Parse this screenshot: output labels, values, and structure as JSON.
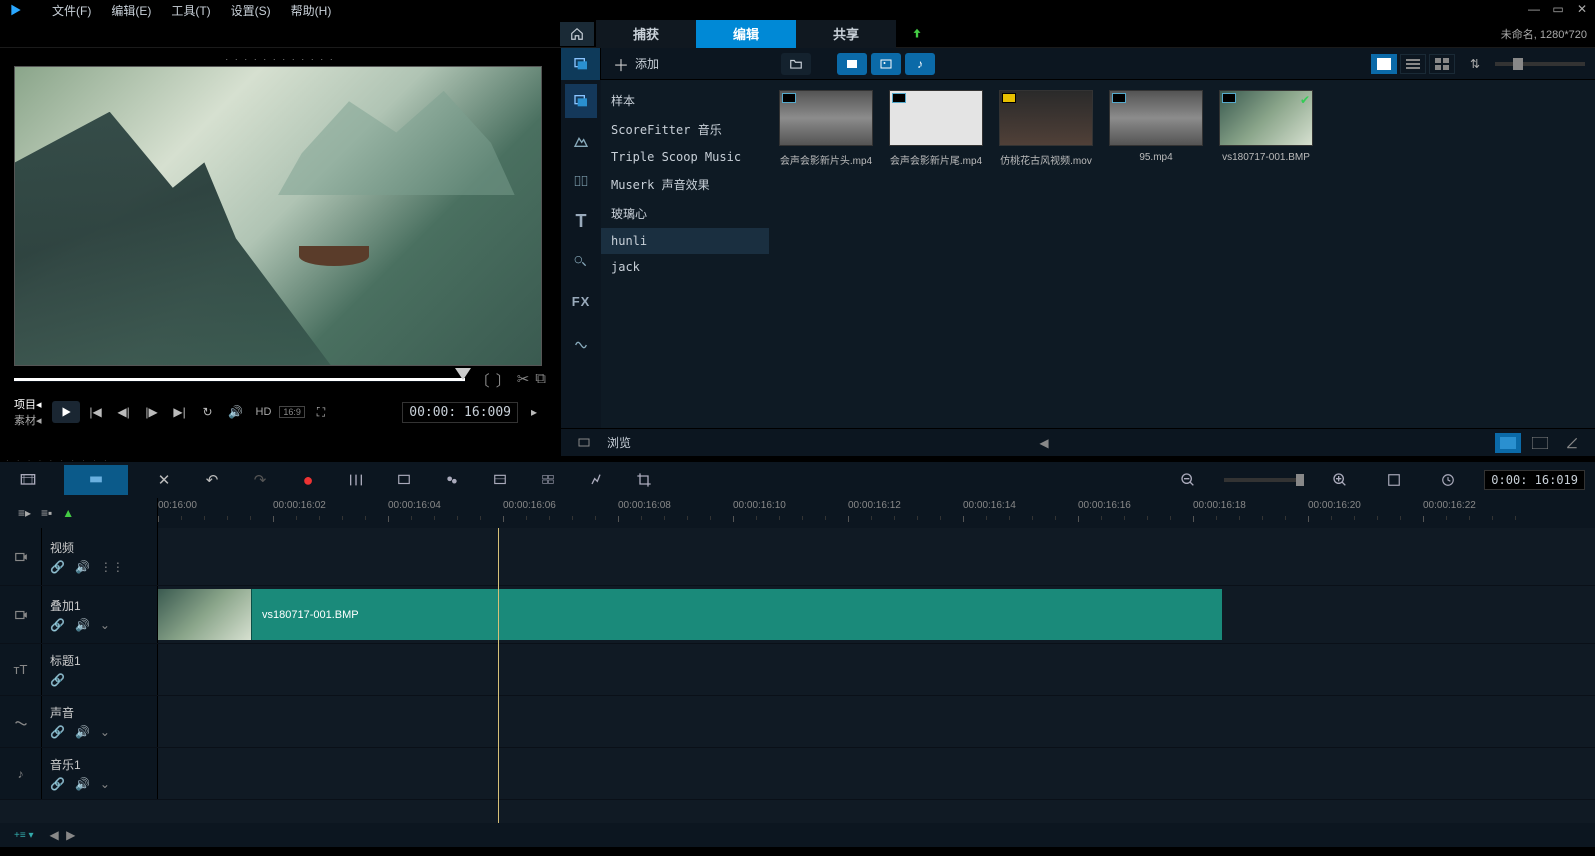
{
  "menubar": {
    "items": [
      "文件(F)",
      "编辑(E)",
      "工具(T)",
      "设置(S)",
      "帮助(H)"
    ]
  },
  "tabs": {
    "items": [
      "捕获",
      "编辑",
      "共享"
    ],
    "active_index": 1
  },
  "project_info": "未命名, 1280*720",
  "preview": {
    "mode_project": "项目",
    "mode_clip": "素材",
    "hd_label": "HD",
    "ratio": "16:9",
    "timecode": "00:00: 16:009"
  },
  "media": {
    "add_label": "添加",
    "folders": [
      "样本",
      "ScoreFitter 音乐",
      "Triple Scoop Music",
      "Muserk 声音效果",
      "玻璃心",
      "hunli",
      "jack"
    ],
    "active_folder_index": 5,
    "browse_label": "浏览",
    "thumbs": [
      {
        "label": "会声会影新片头.mp4",
        "style": "grey"
      },
      {
        "label": "会声会影新片尾.mp4",
        "style": "white"
      },
      {
        "label": "仿桃花古风视频.mov",
        "style": "peach",
        "badge_color": "#e8c000"
      },
      {
        "label": "95.mp4",
        "style": "grey"
      },
      {
        "label": "vs180717-001.BMP",
        "style": "ink",
        "checked": true
      }
    ]
  },
  "timeline": {
    "ruler": [
      "00:16:00",
      "00:00:16:02",
      "00:00:16:04",
      "00:00:16:06",
      "00:00:16:08",
      "00:00:16:10",
      "00:00:16:12",
      "00:00:16:14",
      "00:00:16:16",
      "00:00:16:18",
      "00:00:16:20",
      "00:00:16:22"
    ],
    "zoom_tc": "0:00: 16:019",
    "tracks": {
      "video": {
        "label": "视频"
      },
      "overlay": {
        "label": "叠加1"
      },
      "title": {
        "label": "标题1"
      },
      "voice": {
        "label": "声音"
      },
      "music": {
        "label": "音乐1"
      }
    },
    "clip": {
      "label": "vs180717-001.BMP"
    }
  }
}
